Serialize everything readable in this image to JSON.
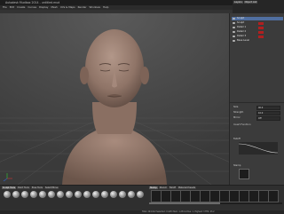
{
  "window": {
    "title": "Autodesk Mudbox 2014 - untitled.mud",
    "min": "–",
    "max": "□",
    "close": "×"
  },
  "menu": [
    "File",
    "Edit",
    "Create",
    "Curves",
    "Display",
    "Mesh",
    "UVs & Maps",
    "Render",
    "Windows",
    "Help"
  ],
  "layers_panel": {
    "tabs": [
      "Layers",
      "Object List",
      "Viewport Filters"
    ],
    "items": [
      {
        "label": "Sculpt",
        "selected": true
      },
      {
        "label": "Sculpt",
        "selected": false
      },
      {
        "label": "Detail 1",
        "selected": false
      },
      {
        "label": "Detail 2",
        "selected": false
      },
      {
        "label": "Detail 3",
        "selected": false
      },
      {
        "label": "Base Level",
        "selected": false
      }
    ]
  },
  "properties": {
    "rows": [
      {
        "label": "Size",
        "value": "40.0"
      },
      {
        "label": "Strength",
        "value": "10.0"
      },
      {
        "label": "Mirror",
        "value": "Off"
      },
      {
        "label": "Invert Function",
        "value": ""
      },
      {
        "label": "Falloff",
        "value": ""
      },
      {
        "label": "Stamp",
        "value": ""
      }
    ]
  },
  "shelf": {
    "tabs": [
      "Sculpt Tools",
      "Paint Tools",
      "Pose Tools",
      "Select/Move",
      "Stamp",
      "Stencil",
      "Falloff",
      "Material Presets",
      "Lighting Presets",
      "Camera Bookmarks"
    ],
    "active": "Sculpt Tools"
  },
  "status": "Total: 294,912 Selected: 0 GPU Mem: 1,234 Active: 1, Highest: 3 FPS: 43.2"
}
